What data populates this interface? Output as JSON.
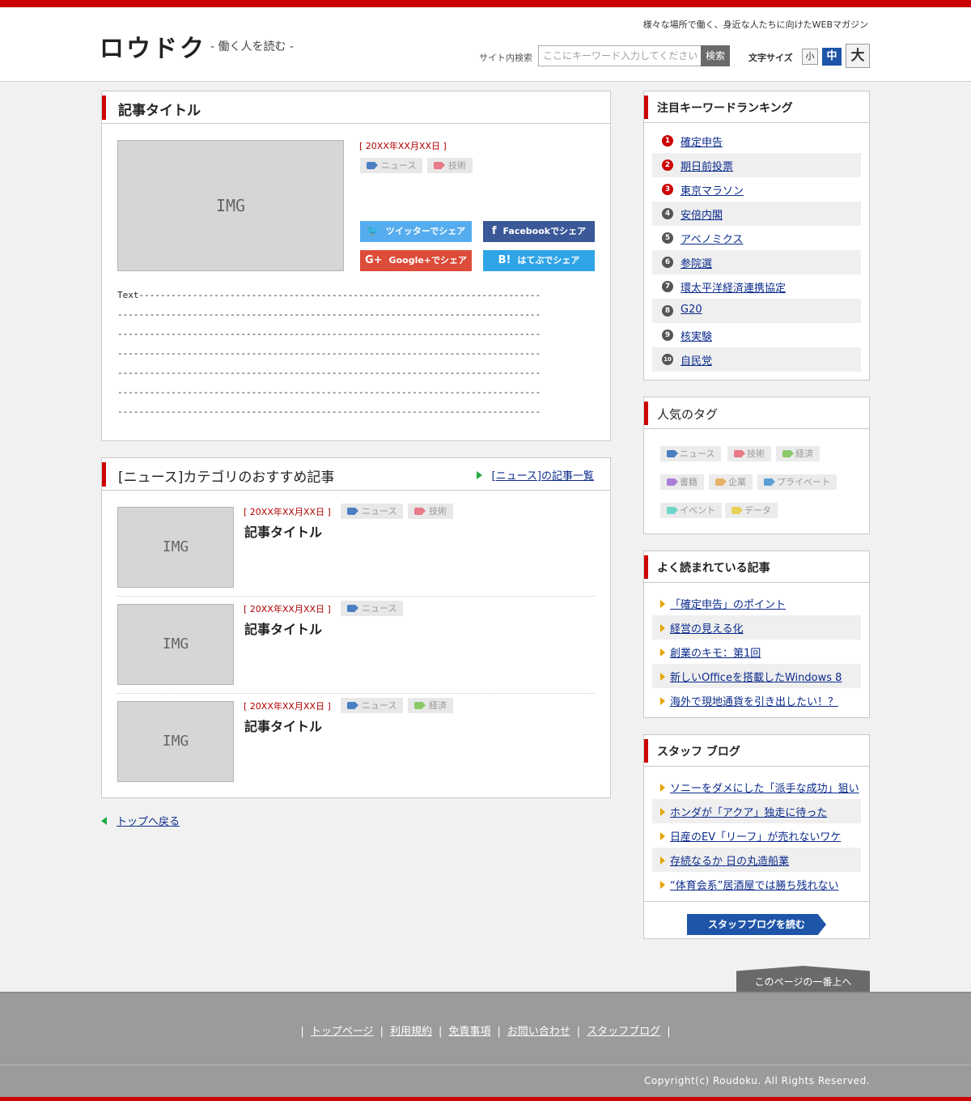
{
  "header": {
    "logo": "ロウドク",
    "tagline": "- 働く人を読む -",
    "catch": "様々な場所で働く、身近な人たちに向けたWEBマガジン",
    "search_label": "サイト内検索",
    "search_placeholder": "ここにキーワード入力してください",
    "search_button": "検索",
    "font_size_label": "文字サイズ",
    "font_small": "小",
    "font_medium": "中",
    "font_large": "大"
  },
  "article": {
    "title": "記事タイトル",
    "image_text": "IMG",
    "date": "[ 20XX年XX月XX日 ]",
    "tags": [
      "ニュース",
      "技術"
    ],
    "share": {
      "twitter": "ツイッターでシェア",
      "facebook": "Facebookでシェア",
      "google": "Google+でシェア",
      "hatena": "はてぶでシェア"
    },
    "body_lines": [
      "Text---------------------------------------------------------------------------",
      "-------------------------------------------------------------------------------",
      "-------------------------------------------------------------------------------",
      "-------------------------------------------------------------------------------",
      "-------------------------------------------------------------------------------",
      "-------------------------------------------------------------------------------",
      "-------------------------------------------------------------------------------"
    ]
  },
  "recommend": {
    "title": "[ニュース]カテゴリのおすすめ記事",
    "more_link": "[ニュース]の記事一覧",
    "items": [
      {
        "image_text": "IMG",
        "date": "[ 20XX年XX月XX日 ]",
        "tags": [
          "ニュース",
          "技術"
        ],
        "title": "記事タイトル"
      },
      {
        "image_text": "IMG",
        "date": "[ 20XX年XX月XX日 ]",
        "tags": [
          "ニュース"
        ],
        "title": "記事タイトル"
      },
      {
        "image_text": "IMG",
        "date": "[ 20XX年XX月XX日 ]",
        "tags": [
          "ニュース",
          "経済"
        ],
        "title": "記事タイトル"
      }
    ]
  },
  "back_link": "トップへ戻る",
  "ranking": {
    "title": "注目キーワードランキング",
    "items": [
      {
        "num": "1",
        "label": "確定申告"
      },
      {
        "num": "2",
        "label": "期日前投票"
      },
      {
        "num": "3",
        "label": "東京マラソン"
      },
      {
        "num": "4",
        "label": "安倍内閣"
      },
      {
        "num": "5",
        "label": "アベノミクス"
      },
      {
        "num": "6",
        "label": "参院選"
      },
      {
        "num": "7",
        "label": "環太平洋経済連携協定"
      },
      {
        "num": "8",
        "label": "G20"
      },
      {
        "num": "9",
        "label": "核実験"
      },
      {
        "num": "10",
        "label": "自民党"
      }
    ],
    "top_color": "#cc0000",
    "other_color": "#555555"
  },
  "popular_tags": {
    "title": "人気のタグ",
    "tags": [
      {
        "label": "ニュース",
        "color": "#4a7fc1"
      },
      {
        "label": "技術",
        "color": "#e87a8a"
      },
      {
        "label": "経済",
        "color": "#8bc96b"
      },
      {
        "label": "書籍",
        "color": "#a87fd6"
      },
      {
        "label": "企業",
        "color": "#e8b26a"
      },
      {
        "label": "プライベート",
        "color": "#5a9fd6"
      },
      {
        "label": "イベント",
        "color": "#6fd6c9"
      },
      {
        "label": "データ",
        "color": "#e8d25a"
      }
    ]
  },
  "most_read": {
    "title": "よく読まれている記事",
    "items": [
      "「確定申告」のポイント",
      "経営の見える化",
      "創業のキモ：第1回",
      "新しいOfficeを搭載したWindows 8",
      "海外で現地通貨を引き出したい！？"
    ]
  },
  "staff_blog": {
    "title": "スタッフ ブログ",
    "items": [
      "ソニーをダメにした「派手な成功」狙い",
      "ホンダが「アクア」独走に待った",
      "日産のEV「リーフ」が売れないワケ",
      "存続なるか 日の丸造船業",
      "“体育会系”居酒屋では勝ち残れない"
    ],
    "button": "スタッフブログを読む"
  },
  "to_top": "このページの一番上へ",
  "footer": {
    "links": [
      "トップページ",
      "利用規約",
      "免責事項",
      "お問い合わせ",
      "スタッフブログ"
    ],
    "separator": "|",
    "copyright": "Copyright(c) Roudoku. All Rights Reserved."
  },
  "colors": {
    "accent_red": "#cc0000",
    "twitter": "#55acee",
    "facebook": "#3b5998",
    "google": "#dd4b39",
    "hatena": "#2fa4e7",
    "link": "#0b2b8c"
  }
}
